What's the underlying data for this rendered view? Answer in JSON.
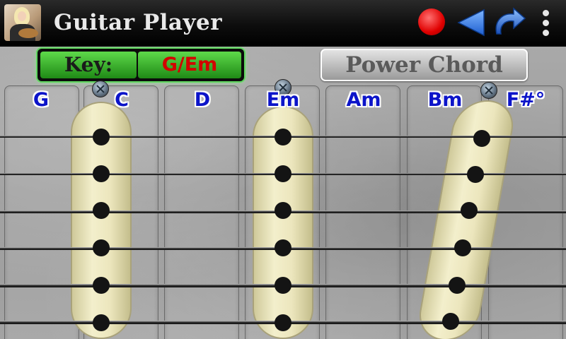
{
  "app_bar": {
    "title": "Guitar Player",
    "icons": {
      "app_icon": "guitar-player-app-icon",
      "record": "record-icon",
      "back": "back-arrow-icon",
      "redo": "redo-arrow-icon",
      "menu": "overflow-menu-icon"
    },
    "colors": {
      "record": "#e00000",
      "back": "#1e73e6",
      "redo": "#1a5fd0"
    }
  },
  "key": {
    "label": "Key:",
    "value": "G/Em",
    "value_color": "#d40000",
    "glow_color": "#5fd65f"
  },
  "mode_button": {
    "label": "Power Chord"
  },
  "chords": [
    {
      "label": "G"
    },
    {
      "label": "C"
    },
    {
      "label": "D"
    },
    {
      "label": "Em"
    },
    {
      "label": "Am"
    },
    {
      "label": "Bm"
    },
    {
      "label": "F#°"
    }
  ],
  "chord_label_color": "#0c14c9",
  "strings_count": 6,
  "pickups": [
    {
      "id": "pickup-c",
      "column": "C"
    },
    {
      "id": "pickup-em",
      "column": "Em"
    },
    {
      "id": "pickup-bm",
      "column": "Bm",
      "slanted": true
    }
  ]
}
